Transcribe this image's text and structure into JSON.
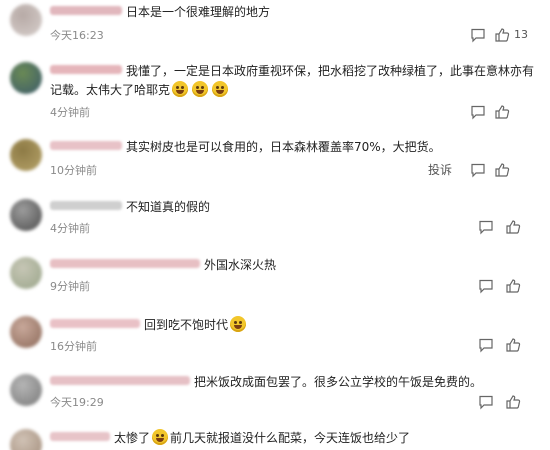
{
  "comments": [
    {
      "text": "日本是一个很难理解的地方",
      "time": "今天16:23",
      "likes": "13",
      "avatar_colors": [
        "#d7cfcc",
        "#b7aaa6"
      ],
      "name_color": "#e1b7bd"
    },
    {
      "text": "我懂了，一定是日本政府重视环保，把水稻挖了改种绿植了，此事在意林亦有记载。太伟大了哈耶克",
      "time": "4分钟前",
      "likes": "",
      "avatar_colors": [
        "#3b5a6b",
        "#6a8a55"
      ],
      "name_color": "#e5b5ba"
    },
    {
      "text": "其实树皮也是可以食用的，日本森林覆盖率70%，大把货。",
      "time": "10分钟前",
      "likes": "",
      "report": "投诉",
      "avatar_colors": [
        "#b7a46a",
        "#8d7a45"
      ],
      "name_color": "#e8c2c7"
    },
    {
      "text": "不知道真的假的",
      "time": "4分钟前",
      "likes": "",
      "avatar_colors": [
        "#4d4d4d",
        "#9c9c9c"
      ],
      "name_color": "#cfcfcf"
    },
    {
      "text": "外国水深火热",
      "time": "9分钟前",
      "likes": "",
      "avatar_colors": [
        "#9aa58a",
        "#c6c6b5"
      ],
      "name_color": "#e7bfc3"
    },
    {
      "text": "回到吃不饱时代",
      "time": "16分钟前",
      "likes": "",
      "avatar_colors": [
        "#8c6a5a",
        "#c8a89a"
      ],
      "name_color": "#e9c1c6"
    },
    {
      "text": "把米饭改成面包罢了。很多公立学校的午饭是免费的。",
      "time": "今天19:29",
      "likes": "",
      "avatar_colors": [
        "#7a7a7a",
        "#b5b5b5"
      ],
      "name_color": "#e6c0c5"
    },
    {
      "text_a": "太惨了",
      "text_b": "前几天就报道没什么配菜，今天连饭也给少了",
      "time": "",
      "likes": "",
      "avatar_colors": [
        "#a28c7a",
        "#d0c2b5"
      ],
      "name_color": "#e7c4c8"
    }
  ],
  "icons": {
    "reply": "reply-icon",
    "share": "share-icon",
    "like": "thumbs-up-icon"
  }
}
